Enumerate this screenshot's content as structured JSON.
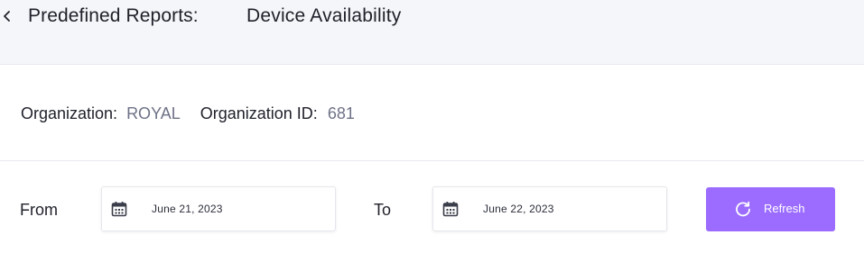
{
  "header": {
    "title_label": "Predefined Reports:",
    "title_value": "Device Availability",
    "back_icon": "chevron-left-icon"
  },
  "organization": {
    "label": "Organization:",
    "value": "ROYAL",
    "id_label": "Organization ID:",
    "id_value": "681"
  },
  "filters": {
    "from_label": "From",
    "from_date": "June 21, 2023",
    "to_label": "To",
    "to_date": "June 22, 2023",
    "calendar_icon": "calendar-icon"
  },
  "actions": {
    "refresh_label": "Refresh",
    "refresh_icon": "refresh-icon",
    "accent_color": "#9b6cff"
  }
}
